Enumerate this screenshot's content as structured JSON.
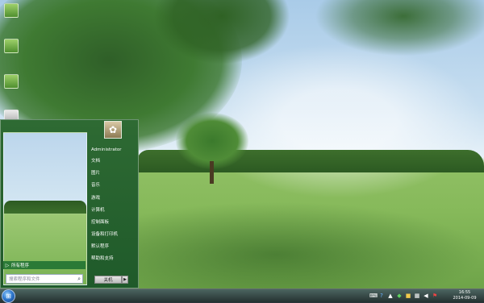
{
  "start_menu": {
    "user_pic_icon": "flower-icon",
    "right_items": [
      "Administrator",
      "文档",
      "图片",
      "音乐",
      "游戏",
      "计算机",
      "控制面板",
      "设备和打印机",
      "默认程序",
      "帮助和支持"
    ],
    "all_programs": "所有程序",
    "search_placeholder": "搜索程序和文件",
    "shutdown": "关机"
  },
  "taskbar": {
    "time": "16:55",
    "date": "2014-09-09",
    "tray_icons": [
      "keyboard-icon",
      "help-icon",
      "notification-icon",
      "shield-icon",
      "folder-icon",
      "network-icon",
      "volume-icon",
      "flag-icon"
    ]
  },
  "desktop": {
    "icons": [
      "desktop-icon-computer",
      "desktop-icon-folder",
      "desktop-icon-network",
      "desktop-icon-recycle-bin"
    ]
  }
}
